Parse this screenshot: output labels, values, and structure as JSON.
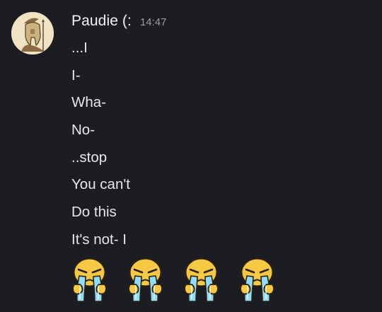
{
  "message": {
    "author": "Paudie (:",
    "timestamp": "14:47",
    "lines": [
      "...I",
      "I-",
      "Wha-",
      "No-",
      "..stop",
      "You can't",
      "Do this",
      "It's not- I"
    ],
    "emojis": [
      "crying-face-emoji",
      "crying-face-emoji",
      "crying-face-emoji",
      "crying-face-emoji"
    ]
  }
}
